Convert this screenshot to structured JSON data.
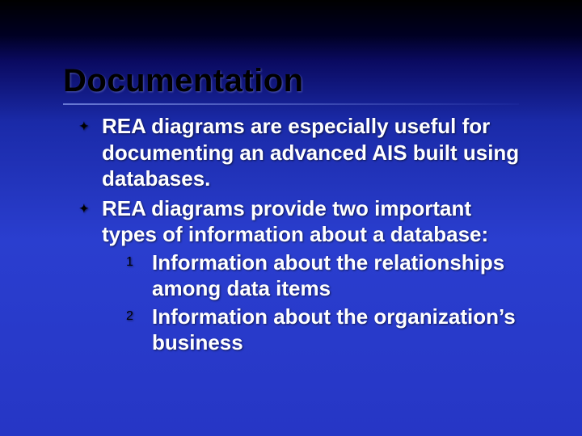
{
  "title": "Documentation",
  "bullets": [
    {
      "text": "REA diagrams are especially useful for documenting an advanced AIS built using databases."
    },
    {
      "text": "REA diagrams provide two important types  of information about a database:",
      "numbered": [
        "Information about the relationships among data items",
        "Information about the organization’s business"
      ]
    }
  ],
  "markers": {
    "bullet": "✦",
    "n1": "1",
    "n2": "2"
  }
}
